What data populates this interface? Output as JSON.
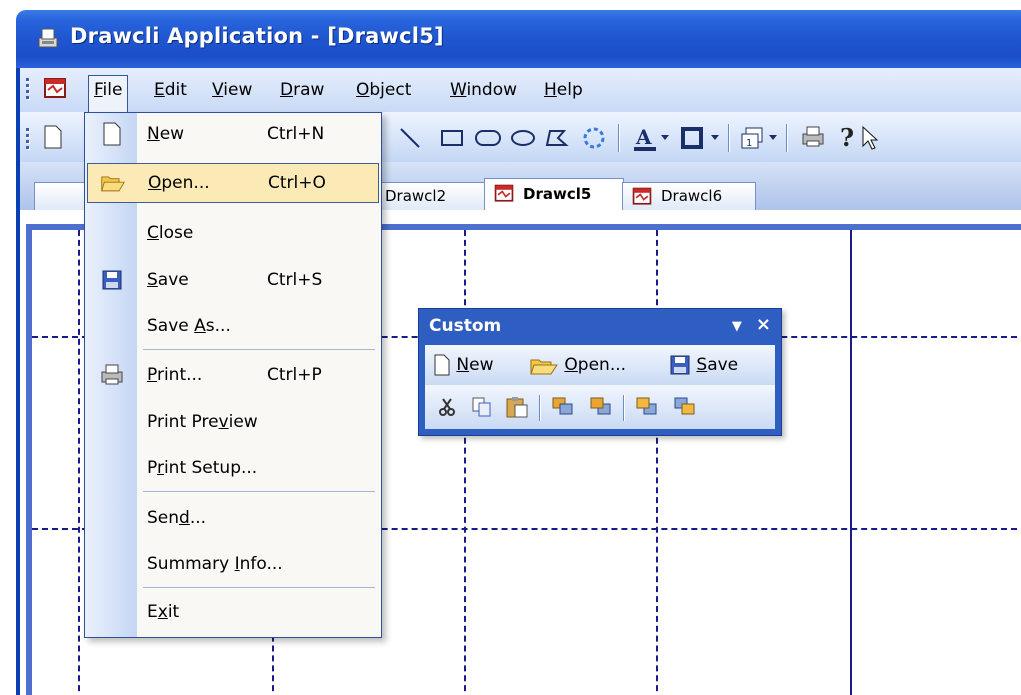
{
  "window": {
    "title": "Drawcli Application - [Drawcl5]"
  },
  "menubar": {
    "items": [
      {
        "label_pre": "",
        "label_u": "F",
        "label_post": "ile"
      },
      {
        "label_pre": "",
        "label_u": "E",
        "label_post": "dit"
      },
      {
        "label_pre": "",
        "label_u": "V",
        "label_post": "iew"
      },
      {
        "label_pre": "",
        "label_u": "D",
        "label_post": "raw"
      },
      {
        "label_pre": "",
        "label_u": "O",
        "label_post": "bject"
      },
      {
        "label_pre": "",
        "label_u": "W",
        "label_post": "indow"
      },
      {
        "label_pre": "",
        "label_u": "H",
        "label_post": "elp"
      }
    ]
  },
  "tabs": [
    {
      "label": "Drawcl2"
    },
    {
      "label": "Drawcl5"
    },
    {
      "label": "Drawcl6"
    }
  ],
  "file_menu": {
    "items": [
      {
        "pre": "",
        "u": "N",
        "post": "ew",
        "shortcut": "Ctrl+N",
        "icon": "new-document-icon"
      },
      {
        "pre": "",
        "u": "O",
        "post": "pen...",
        "shortcut": "Ctrl+O",
        "icon": "open-folder-icon"
      },
      {
        "pre": "",
        "u": "C",
        "post": "lose",
        "shortcut": "",
        "icon": ""
      },
      {
        "pre": "",
        "u": "S",
        "post": "ave",
        "shortcut": "Ctrl+S",
        "icon": "save-disk-icon"
      },
      {
        "pre": "Save ",
        "u": "A",
        "post": "s...",
        "shortcut": "",
        "icon": ""
      },
      {
        "pre": "",
        "u": "P",
        "post": "rint...",
        "shortcut": "Ctrl+P",
        "icon": "printer-icon"
      },
      {
        "pre": "Print Pre",
        "u": "v",
        "post": "iew",
        "shortcut": "",
        "icon": ""
      },
      {
        "pre": "P",
        "u": "r",
        "post": "int Setup...",
        "shortcut": "",
        "icon": ""
      },
      {
        "pre": "Sen",
        "u": "d",
        "post": "...",
        "shortcut": "",
        "icon": ""
      },
      {
        "pre": "Summary ",
        "u": "I",
        "post": "nfo...",
        "shortcut": "",
        "icon": ""
      },
      {
        "pre": "E",
        "u": "x",
        "post": "it",
        "shortcut": "",
        "icon": ""
      }
    ],
    "highlighted": "Open..."
  },
  "custom_toolbar": {
    "title": "Custom",
    "new": {
      "u": "N",
      "post": "ew"
    },
    "open": {
      "u": "O",
      "post": "pen..."
    },
    "save": {
      "u": "S",
      "post": "ave"
    }
  },
  "colors": {
    "titlebar": "#1f56d0",
    "menu_highlight": "#fbeab6",
    "gridline": "#1a1a8a"
  }
}
